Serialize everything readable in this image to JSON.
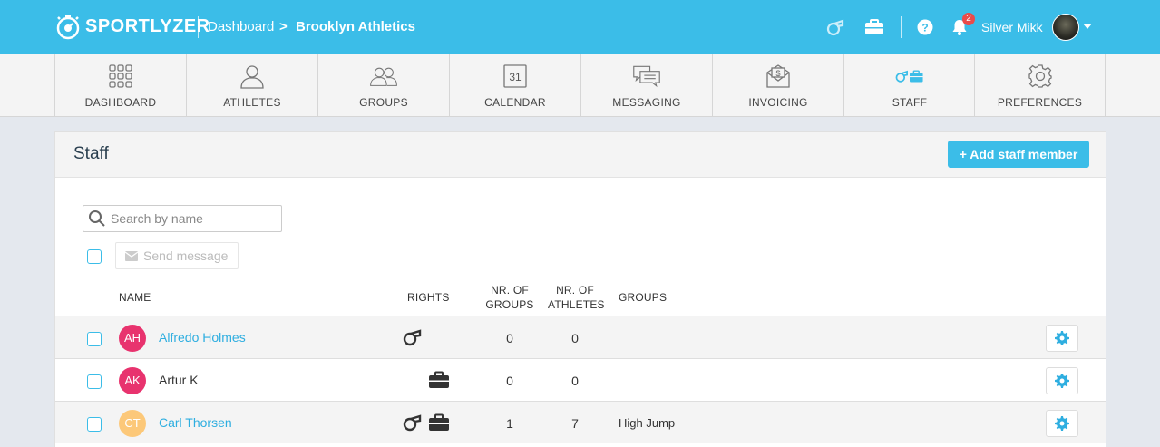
{
  "topbar": {
    "logo_text": "SPORTLYZER",
    "breadcrumb_root": "Dashboard",
    "breadcrumb_sep": ">",
    "breadcrumb_current": "Brooklyn Athletics",
    "notification_count": "2",
    "user_name": "Silver Mikk"
  },
  "nav": {
    "items": [
      {
        "label": "DASHBOARD",
        "icon": "grid-icon"
      },
      {
        "label": "ATHLETES",
        "icon": "person-icon"
      },
      {
        "label": "GROUPS",
        "icon": "people-icon"
      },
      {
        "label": "CALENDAR",
        "icon": "calendar-icon",
        "icon_text": "31"
      },
      {
        "label": "MESSAGING",
        "icon": "chat-icon"
      },
      {
        "label": "INVOICING",
        "icon": "invoice-icon"
      },
      {
        "label": "STAFF",
        "icon": "coach-briefcase-icon",
        "active": true
      },
      {
        "label": "PREFERENCES",
        "icon": "gear-icon"
      }
    ]
  },
  "panel": {
    "title": "Staff",
    "add_button": "Add staff member",
    "search_placeholder": "Search by name",
    "send_message": "Send message"
  },
  "table": {
    "headers": {
      "name": "NAME",
      "rights": "RIGHTS",
      "nr_groups_1": "NR. OF",
      "nr_groups_2": "GROUPS",
      "nr_athletes_1": "NR. OF",
      "nr_athletes_2": "ATHLETES",
      "groups": "GROUPS"
    },
    "rows": [
      {
        "initials": "AH",
        "name": "Alfredo Holmes",
        "avatar_color": "#e8336e",
        "rights": [
          "whistle"
        ],
        "nr_groups": "0",
        "nr_athletes": "0",
        "groups": ""
      },
      {
        "initials": "AK",
        "name": "Artur K",
        "avatar_color": "#e8336e",
        "rights": [
          "briefcase"
        ],
        "nr_groups": "0",
        "nr_athletes": "0",
        "groups": ""
      },
      {
        "initials": "CT",
        "name": "Carl Thorsen",
        "avatar_color": "#fcc879",
        "rights": [
          "whistle",
          "briefcase"
        ],
        "nr_groups": "1",
        "nr_athletes": "7",
        "groups": "High Jump"
      }
    ]
  },
  "colors": {
    "accent": "#3bbde8",
    "link": "#2eaee0",
    "badge": "#e94b4b"
  }
}
